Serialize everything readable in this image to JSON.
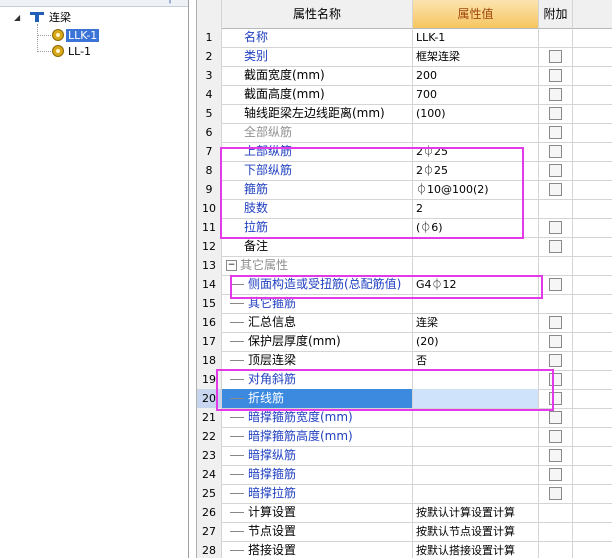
{
  "tree": {
    "root": {
      "label": "连梁"
    },
    "children": [
      {
        "label": "LLK-1",
        "selected": true
      },
      {
        "label": "LL-1",
        "selected": false
      }
    ]
  },
  "table": {
    "headers": {
      "num": "",
      "name": "属性名称",
      "value": "属性值",
      "add": "附加"
    },
    "rows": [
      {
        "num": "1",
        "name": "名称",
        "value": "LLK-1",
        "style": "blue",
        "checkbox": false
      },
      {
        "num": "2",
        "name": "类别",
        "value": "框架连梁",
        "style": "blue",
        "checkbox": true
      },
      {
        "num": "3",
        "name": "截面宽度(mm)",
        "value": "200",
        "style": "black",
        "checkbox": true
      },
      {
        "num": "4",
        "name": "截面高度(mm)",
        "value": "700",
        "style": "black",
        "checkbox": true
      },
      {
        "num": "5",
        "name": "轴线距梁左边线距离(mm)",
        "value": "(100)",
        "style": "black",
        "checkbox": true
      },
      {
        "num": "6",
        "name": "全部纵筋",
        "value": "",
        "style": "gray",
        "checkbox": true
      },
      {
        "num": "7",
        "name": "上部纵筋",
        "value": "2⏀25",
        "style": "blue",
        "checkbox": true
      },
      {
        "num": "8",
        "name": "下部纵筋",
        "value": "2⏀25",
        "style": "blue",
        "checkbox": true
      },
      {
        "num": "9",
        "name": "箍筋",
        "value": "⏀10@100(2)",
        "style": "blue",
        "checkbox": true
      },
      {
        "num": "10",
        "name": "肢数",
        "value": "2",
        "style": "blue",
        "checkbox": false
      },
      {
        "num": "11",
        "name": "拉筋",
        "value": "(⏀6)",
        "style": "blue",
        "checkbox": true
      },
      {
        "num": "12",
        "name": "备注",
        "value": "",
        "style": "black",
        "checkbox": true
      },
      {
        "num": "13",
        "name": "其它属性",
        "value": "",
        "style": "group",
        "checkbox": false
      },
      {
        "num": "14",
        "name": "侧面构造或受扭筋(总配筋值)",
        "value": "G4⏀12",
        "style": "blue-sub",
        "checkbox": true
      },
      {
        "num": "15",
        "name": "其它箍筋",
        "value": "",
        "style": "blue-sub",
        "checkbox": false
      },
      {
        "num": "16",
        "name": "汇总信息",
        "value": "连梁",
        "style": "black-sub",
        "checkbox": true
      },
      {
        "num": "17",
        "name": "保护层厚度(mm)",
        "value": "(20)",
        "style": "black-sub",
        "checkbox": true
      },
      {
        "num": "18",
        "name": "顶层连梁",
        "value": "否",
        "style": "black-sub",
        "checkbox": true
      },
      {
        "num": "19",
        "name": "对角斜筋",
        "value": "",
        "style": "blue-sub",
        "checkbox": true
      },
      {
        "num": "20",
        "name": "折线筋",
        "value": "",
        "style": "active",
        "checkbox": true
      },
      {
        "num": "21",
        "name": "暗撑箍筋宽度(mm)",
        "value": "",
        "style": "blue-sub",
        "checkbox": true
      },
      {
        "num": "22",
        "name": "暗撑箍筋高度(mm)",
        "value": "",
        "style": "blue-sub",
        "checkbox": true
      },
      {
        "num": "23",
        "name": "暗撑纵筋",
        "value": "",
        "style": "blue-sub",
        "checkbox": true
      },
      {
        "num": "24",
        "name": "暗撑箍筋",
        "value": "",
        "style": "blue-sub",
        "checkbox": true
      },
      {
        "num": "25",
        "name": "暗撑拉筋",
        "value": "",
        "style": "blue-sub",
        "checkbox": true
      },
      {
        "num": "26",
        "name": "计算设置",
        "value": "按默认计算设置计算",
        "style": "black-sub",
        "checkbox": false
      },
      {
        "num": "27",
        "name": "节点设置",
        "value": "按默认节点设置计算",
        "style": "black-sub",
        "checkbox": false
      },
      {
        "num": "28",
        "name": "搭接设置",
        "value": "按默认搭接设置计算",
        "style": "black-sub",
        "checkbox": false
      }
    ]
  },
  "colors": {
    "highlight": "#e23ae6",
    "selection": "#3b8ae0",
    "header_value": "#f6c660",
    "blue_text": "#1f3fc0"
  }
}
